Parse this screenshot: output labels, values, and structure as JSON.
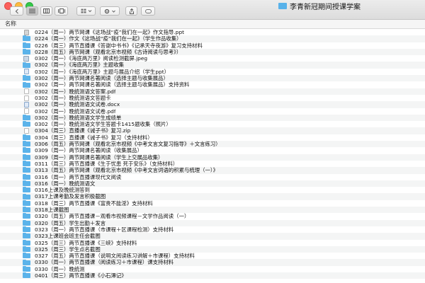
{
  "window": {
    "title": "李青新冠期间授课学案"
  },
  "column_header": "名称",
  "rows": [
    {
      "icon": "file-gray",
      "name": "0224（周一）两节网课《这场战“疫”我们在一起》作文指导.ppt"
    },
    {
      "icon": "folder",
      "name": "0224（周一）作文《这场战“疫”我们在一起》（学生作品收集）"
    },
    {
      "icon": "folder",
      "name": "0226（周三）两节直播课《答谢中书书》《记承天寺夜游》复习支持材料"
    },
    {
      "icon": "folder",
      "name": "0228（周五）两节网课（观看北京市视频《古诗阅读与思考》）"
    },
    {
      "icon": "img",
      "name": "0302（周一）《海底两万里》阅读检测截屏.jpeg"
    },
    {
      "icon": "folder",
      "name": "0302（周一）《海底两万里》主题收集"
    },
    {
      "icon": "file-blue",
      "name": "0302（周一）《海底两万里》主题与展品介绍（学生ppt）"
    },
    {
      "icon": "folder",
      "name": "0302（周一）两节网课名著阅读（选择主题与收集展品）"
    },
    {
      "icon": "folder",
      "name": "0302（周一）两节网课名著阅读（选择主题与收集展品）支持资料"
    },
    {
      "icon": "file",
      "name": "0302（周一）晚统测语文答案.pdf"
    },
    {
      "icon": "file",
      "name": "0302（周一）晚统测语文答题卡"
    },
    {
      "icon": "file-blue",
      "name": "0302（周一）晚统测语文试卷.docx"
    },
    {
      "icon": "file",
      "name": "0302（周一）晚统测语文试卷.pdf"
    },
    {
      "icon": "folder",
      "name": "0302（周一）晚统测语文学生成绩单"
    },
    {
      "icon": "folder",
      "name": "0302（周一）晚统测语文学生答题卡1415题收集（照片）"
    },
    {
      "icon": "file",
      "name": "0304（周三）直播课《诫子书》复习.zip"
    },
    {
      "icon": "folder",
      "name": "0304（周三）直播课《诫子书》复习（支持材料）"
    },
    {
      "icon": "folder",
      "name": "0306（周五）两节网课（观看北京市视频《中考文言文复习指导》＋文言练习）"
    },
    {
      "icon": "folder",
      "name": "0309（周一）两节网课名著阅读（收集展品）"
    },
    {
      "icon": "folder",
      "name": "0309（周一）两节网课名著阅读（学生上交展品收集）"
    },
    {
      "icon": "folder",
      "name": "0311（周三）两节直播课《生于忧患 死于安乐》（支持材料）"
    },
    {
      "icon": "folder",
      "name": "0313（周五）两节网课（观看北京市视频《中考文言词语的积累与梳理（一）》"
    },
    {
      "icon": "folder",
      "name": "0316（周一）两节直播课现代文阅读"
    },
    {
      "icon": "folder",
      "name": "0316（周一）晚统测语文"
    },
    {
      "icon": "folder",
      "name": "0316上课及晚统测答到"
    },
    {
      "icon": "folder",
      "name": "0317上课考勤及发言积极截图"
    },
    {
      "icon": "folder",
      "name": "0318（周三）两节直播课《富贵不能淫》支持材料"
    },
    {
      "icon": "folder",
      "name": "0318上课截图"
    },
    {
      "icon": "folder",
      "name": "0320（周五）两节直播课－观看市视频课程－文学作品阅读（一）"
    },
    {
      "icon": "folder",
      "name": "0320（周五）学生出勤＋发言"
    },
    {
      "icon": "folder",
      "name": "0323（周一）两节直播课（市课程＋区课程检测）支持材料"
    },
    {
      "icon": "folder",
      "name": "0323上课班会班主任会截图"
    },
    {
      "icon": "folder",
      "name": "0325（周三）两节直播课《三峡》支持材料"
    },
    {
      "icon": "folder",
      "name": "0325（周三）学生点名截图"
    },
    {
      "icon": "folder",
      "name": "0327（周五）两节直播课（说明文阅读练习讲解＋市课程）支持材料"
    },
    {
      "icon": "folder",
      "name": "0330（周一）两节直播课（阅读练习＋市课程）课支持材料"
    },
    {
      "icon": "folder",
      "name": "0330（周一）晚统测"
    },
    {
      "icon": "folder",
      "name": "0401（周三）两节直播课《小石潭记》"
    }
  ]
}
